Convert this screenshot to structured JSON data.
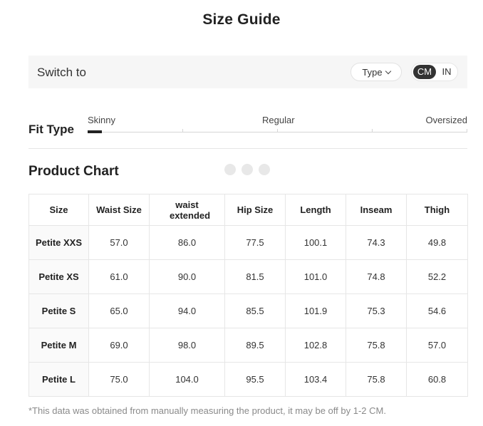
{
  "title": "Size Guide",
  "switch": {
    "label": "Switch to",
    "type_label": "Type",
    "units": [
      "CM",
      "IN"
    ],
    "selected_unit": "CM"
  },
  "fit": {
    "label": "Fit Type",
    "options": [
      "Skinny",
      "Regular",
      "Oversized"
    ],
    "selected": "Skinny"
  },
  "product_chart": {
    "title": "Product Chart",
    "columns": [
      "Size",
      "Waist Size",
      "waist extended",
      "Hip Size",
      "Length",
      "Inseam",
      "Thigh"
    ],
    "rows": [
      [
        "Petite XXS",
        "57.0",
        "86.0",
        "77.5",
        "100.1",
        "74.3",
        "49.8"
      ],
      [
        "Petite XS",
        "61.0",
        "90.0",
        "81.5",
        "101.0",
        "74.8",
        "52.2"
      ],
      [
        "Petite S",
        "65.0",
        "94.0",
        "85.5",
        "101.9",
        "75.3",
        "54.6"
      ],
      [
        "Petite M",
        "69.0",
        "98.0",
        "89.5",
        "102.8",
        "75.8",
        "57.0"
      ],
      [
        "Petite L",
        "75.0",
        "104.0",
        "95.5",
        "103.4",
        "75.8",
        "60.8"
      ]
    ]
  },
  "footnote": "*This data was obtained from manually measuring the product, it may be off by 1-2 CM."
}
